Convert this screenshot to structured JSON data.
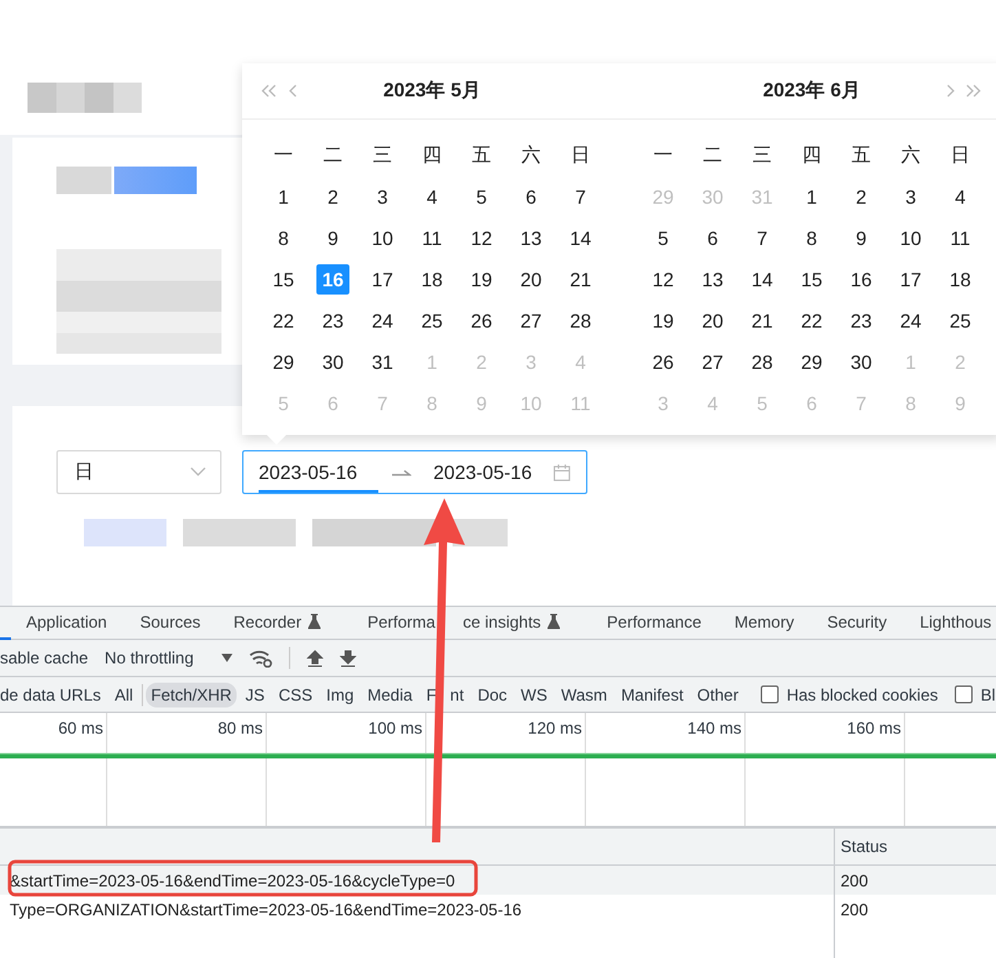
{
  "filter_form": {
    "cycle_select": {
      "value": "日"
    },
    "date_range": {
      "start": {
        "value": "2023-05-16",
        "active": true
      },
      "end": {
        "value": "2023-05-16",
        "active": false
      }
    }
  },
  "calendar": {
    "months": [
      {
        "title": "2023年  5月",
        "weekdays": [
          "一",
          "二",
          "三",
          "四",
          "五",
          "六",
          "日"
        ],
        "weeks": [
          [
            {
              "day": "1",
              "outside": false,
              "selected": false
            },
            {
              "day": "2",
              "outside": false,
              "selected": false
            },
            {
              "day": "3",
              "outside": false,
              "selected": false
            },
            {
              "day": "4",
              "outside": false,
              "selected": false
            },
            {
              "day": "5",
              "outside": false,
              "selected": false
            },
            {
              "day": "6",
              "outside": false,
              "selected": false
            },
            {
              "day": "7",
              "outside": false,
              "selected": false
            }
          ],
          [
            {
              "day": "8",
              "outside": false,
              "selected": false
            },
            {
              "day": "9",
              "outside": false,
              "selected": false
            },
            {
              "day": "10",
              "outside": false,
              "selected": false
            },
            {
              "day": "11",
              "outside": false,
              "selected": false
            },
            {
              "day": "12",
              "outside": false,
              "selected": false
            },
            {
              "day": "13",
              "outside": false,
              "selected": false
            },
            {
              "day": "14",
              "outside": false,
              "selected": false
            }
          ],
          [
            {
              "day": "15",
              "outside": false,
              "selected": false
            },
            {
              "day": "16",
              "outside": false,
              "selected": true
            },
            {
              "day": "17",
              "outside": false,
              "selected": false
            },
            {
              "day": "18",
              "outside": false,
              "selected": false
            },
            {
              "day": "19",
              "outside": false,
              "selected": false
            },
            {
              "day": "20",
              "outside": false,
              "selected": false
            },
            {
              "day": "21",
              "outside": false,
              "selected": false
            }
          ],
          [
            {
              "day": "22",
              "outside": false,
              "selected": false
            },
            {
              "day": "23",
              "outside": false,
              "selected": false
            },
            {
              "day": "24",
              "outside": false,
              "selected": false
            },
            {
              "day": "25",
              "outside": false,
              "selected": false
            },
            {
              "day": "26",
              "outside": false,
              "selected": false
            },
            {
              "day": "27",
              "outside": false,
              "selected": false
            },
            {
              "day": "28",
              "outside": false,
              "selected": false
            }
          ],
          [
            {
              "day": "29",
              "outside": false,
              "selected": false
            },
            {
              "day": "30",
              "outside": false,
              "selected": false
            },
            {
              "day": "31",
              "outside": false,
              "selected": false
            },
            {
              "day": "1",
              "outside": true,
              "selected": false
            },
            {
              "day": "2",
              "outside": true,
              "selected": false
            },
            {
              "day": "3",
              "outside": true,
              "selected": false
            },
            {
              "day": "4",
              "outside": true,
              "selected": false
            }
          ],
          [
            {
              "day": "5",
              "outside": true,
              "selected": false
            },
            {
              "day": "6",
              "outside": true,
              "selected": false
            },
            {
              "day": "7",
              "outside": true,
              "selected": false
            },
            {
              "day": "8",
              "outside": true,
              "selected": false
            },
            {
              "day": "9",
              "outside": true,
              "selected": false
            },
            {
              "day": "10",
              "outside": true,
              "selected": false
            },
            {
              "day": "11",
              "outside": true,
              "selected": false
            }
          ]
        ]
      },
      {
        "title": "2023年  6月",
        "weekdays": [
          "一",
          "二",
          "三",
          "四",
          "五",
          "六",
          "日"
        ],
        "weeks": [
          [
            {
              "day": "29",
              "outside": true,
              "selected": false
            },
            {
              "day": "30",
              "outside": true,
              "selected": false
            },
            {
              "day": "31",
              "outside": true,
              "selected": false
            },
            {
              "day": "1",
              "outside": false,
              "selected": false
            },
            {
              "day": "2",
              "outside": false,
              "selected": false
            },
            {
              "day": "3",
              "outside": false,
              "selected": false
            },
            {
              "day": "4",
              "outside": false,
              "selected": false
            }
          ],
          [
            {
              "day": "5",
              "outside": false,
              "selected": false
            },
            {
              "day": "6",
              "outside": false,
              "selected": false
            },
            {
              "day": "7",
              "outside": false,
              "selected": false
            },
            {
              "day": "8",
              "outside": false,
              "selected": false
            },
            {
              "day": "9",
              "outside": false,
              "selected": false
            },
            {
              "day": "10",
              "outside": false,
              "selected": false
            },
            {
              "day": "11",
              "outside": false,
              "selected": false
            }
          ],
          [
            {
              "day": "12",
              "outside": false,
              "selected": false
            },
            {
              "day": "13",
              "outside": false,
              "selected": false
            },
            {
              "day": "14",
              "outside": false,
              "selected": false
            },
            {
              "day": "15",
              "outside": false,
              "selected": false
            },
            {
              "day": "16",
              "outside": false,
              "selected": false
            },
            {
              "day": "17",
              "outside": false,
              "selected": false
            },
            {
              "day": "18",
              "outside": false,
              "selected": false
            }
          ],
          [
            {
              "day": "19",
              "outside": false,
              "selected": false
            },
            {
              "day": "20",
              "outside": false,
              "selected": false
            },
            {
              "day": "21",
              "outside": false,
              "selected": false
            },
            {
              "day": "22",
              "outside": false,
              "selected": false
            },
            {
              "day": "23",
              "outside": false,
              "selected": false
            },
            {
              "day": "24",
              "outside": false,
              "selected": false
            },
            {
              "day": "25",
              "outside": false,
              "selected": false
            }
          ],
          [
            {
              "day": "26",
              "outside": false,
              "selected": false
            },
            {
              "day": "27",
              "outside": false,
              "selected": false
            },
            {
              "day": "28",
              "outside": false,
              "selected": false
            },
            {
              "day": "29",
              "outside": false,
              "selected": false
            },
            {
              "day": "30",
              "outside": false,
              "selected": false
            },
            {
              "day": "1",
              "outside": true,
              "selected": false
            },
            {
              "day": "2",
              "outside": true,
              "selected": false
            }
          ],
          [
            {
              "day": "3",
              "outside": true,
              "selected": false
            },
            {
              "day": "4",
              "outside": true,
              "selected": false
            },
            {
              "day": "5",
              "outside": true,
              "selected": false
            },
            {
              "day": "6",
              "outside": true,
              "selected": false
            },
            {
              "day": "7",
              "outside": true,
              "selected": false
            },
            {
              "day": "8",
              "outside": true,
              "selected": false
            },
            {
              "day": "9",
              "outside": true,
              "selected": false
            }
          ]
        ]
      }
    ]
  },
  "devtools": {
    "tabs": [
      {
        "label": "Application",
        "experimental": false,
        "selected": false
      },
      {
        "label": "Sources",
        "experimental": false,
        "selected": false
      },
      {
        "label": "Recorder",
        "experimental": true,
        "selected": false
      },
      {
        "label_parts": [
          "Performa",
          "ce insights"
        ],
        "experimental": true,
        "selected": false
      },
      {
        "label": "Performance",
        "experimental": false,
        "selected": false
      },
      {
        "label": "Memory",
        "experimental": false,
        "selected": false
      },
      {
        "label": "Security",
        "experimental": false,
        "selected": false
      },
      {
        "label": "Lighthous",
        "experimental": false,
        "selected": false
      }
    ],
    "toolbar": {
      "cache_label": "sable cache",
      "throttling": "No throttling"
    },
    "filters": {
      "hide_label": "de data URLs",
      "types": [
        {
          "label": "All",
          "selected": false
        },
        {
          "label": "Fetch/XHR",
          "selected": true
        },
        {
          "label": "JS",
          "selected": false
        },
        {
          "label": "CSS",
          "selected": false
        },
        {
          "label": "Img",
          "selected": false
        },
        {
          "label": "Media",
          "selected": false
        },
        {
          "label_parts": [
            "F",
            "nt"
          ],
          "selected": false
        },
        {
          "label": "Doc",
          "selected": false
        },
        {
          "label": "WS",
          "selected": false
        },
        {
          "label": "Wasm",
          "selected": false
        },
        {
          "label": "Manifest",
          "selected": false
        },
        {
          "label": "Other",
          "selected": false
        }
      ],
      "checkboxes": [
        {
          "label": "Has blocked cookies",
          "checked": false
        },
        {
          "label": "Bl",
          "checked": false
        }
      ]
    },
    "timeline_ticks": [
      "60 ms",
      "80 ms",
      "100 ms",
      "120 ms",
      "140 ms",
      "160 ms"
    ],
    "table": {
      "columns": [
        "Status"
      ],
      "rows": [
        {
          "name": "&startTime=2023-05-16&endTime=2023-05-16&cycleType=0",
          "status": "200",
          "highlighted": true
        },
        {
          "name": "Type=ORGANIZATION&startTime=2023-05-16&endTime=2023-05-16",
          "status": "200",
          "highlighted": false
        }
      ]
    }
  }
}
